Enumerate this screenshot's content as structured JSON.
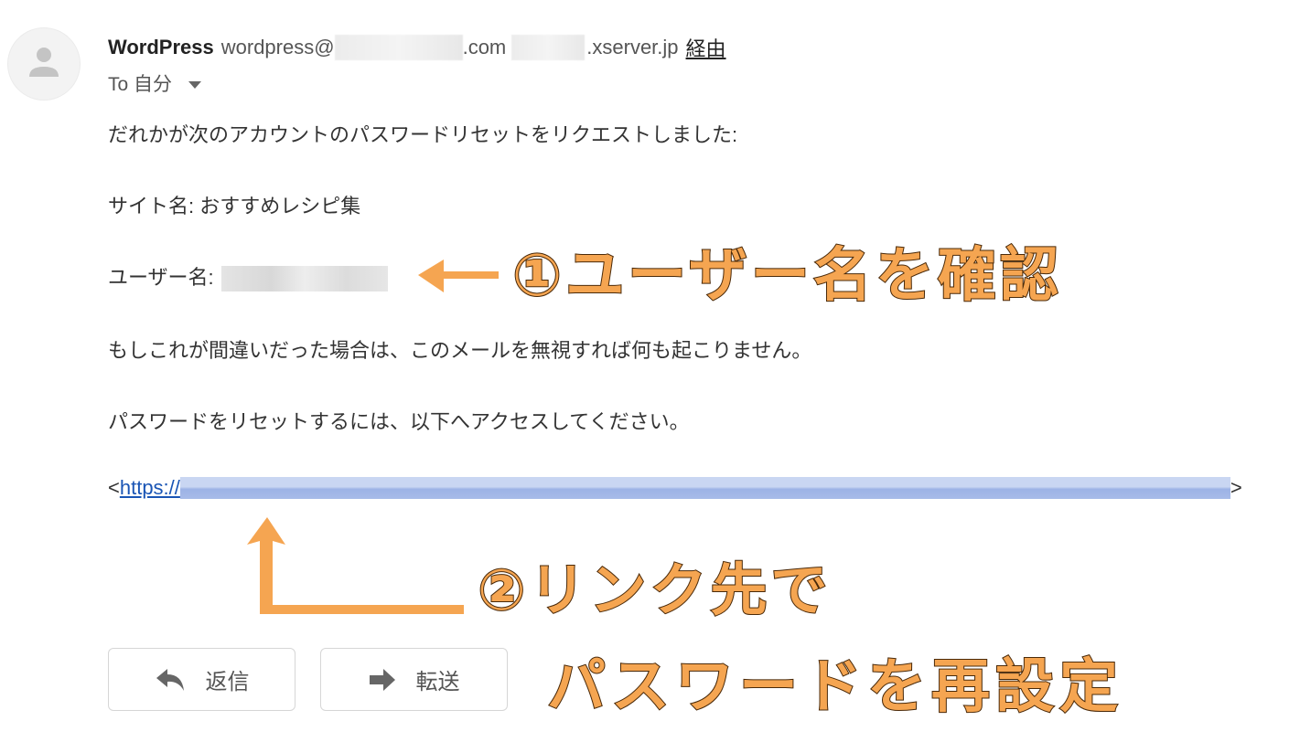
{
  "header": {
    "sender_name": "WordPress",
    "sender_email_prefix": "wordpress@",
    "sender_email_suffix": ".com",
    "server_suffix": ".xserver.jp",
    "via_label": "経由",
    "to_label": "To 自分"
  },
  "body": {
    "line1": "だれかが次のアカウントのパスワードリセットをリクエストしました:",
    "site_line": "サイト名: おすすめレシピ集",
    "user_label": "ユーザー名:",
    "ignore_line": "もしこれが間違いだった場合は、このメールを無視すれば何も起こりません。",
    "reset_line": "パスワードをリセットするには、以下へアクセスしてください。",
    "link_open": "<",
    "link_prefix": "https://",
    "link_close": ">"
  },
  "annotations": {
    "step1": "①ユーザー名を確認",
    "step2_line1": "②リンク先で",
    "step2_line2": "パスワードを再設定",
    "color": "#f5a551"
  },
  "actions": {
    "reply_label": "返信",
    "forward_label": "転送"
  },
  "icons": {
    "avatar": "person-icon",
    "dropdown": "caret-down-icon",
    "reply": "reply-arrow-icon",
    "forward": "forward-arrow-icon"
  }
}
